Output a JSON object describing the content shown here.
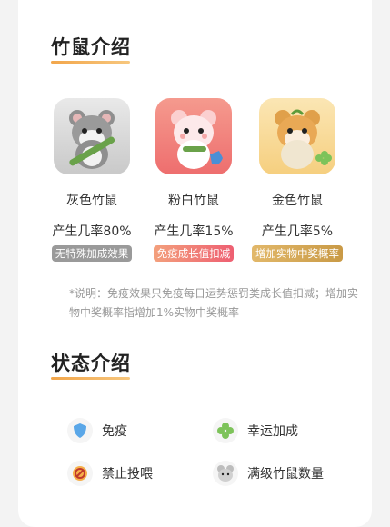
{
  "sections": {
    "intro_title": "竹鼠介绍",
    "status_title": "状态介绍"
  },
  "rats": [
    {
      "name": "灰色竹鼠",
      "rate": "产生几率80%",
      "tag": "无特殊加成效果",
      "tag_color": "#9a9a9a"
    },
    {
      "name": "粉白竹鼠",
      "rate": "产生几率15%",
      "tag": "免疫成长值扣减",
      "tag_color": "#f0707a"
    },
    {
      "name": "金色竹鼠",
      "rate": "产生几率5%",
      "tag": "增加实物中奖概率",
      "tag_color": "#d4aa55"
    }
  ],
  "note": "*说明：免疫效果只免疫每日运势惩罚类成长值扣减；增加实物中奖概率指增加1%实物中奖概率",
  "status_items": [
    {
      "label": "免疫",
      "icon": "shield-icon"
    },
    {
      "label": "幸运加成",
      "icon": "clover-icon"
    },
    {
      "label": "禁止投喂",
      "icon": "no-feeding-icon"
    },
    {
      "label": "满级竹鼠数量",
      "icon": "rat-head-icon"
    }
  ],
  "colors": {
    "accent": "#f2a64b"
  }
}
